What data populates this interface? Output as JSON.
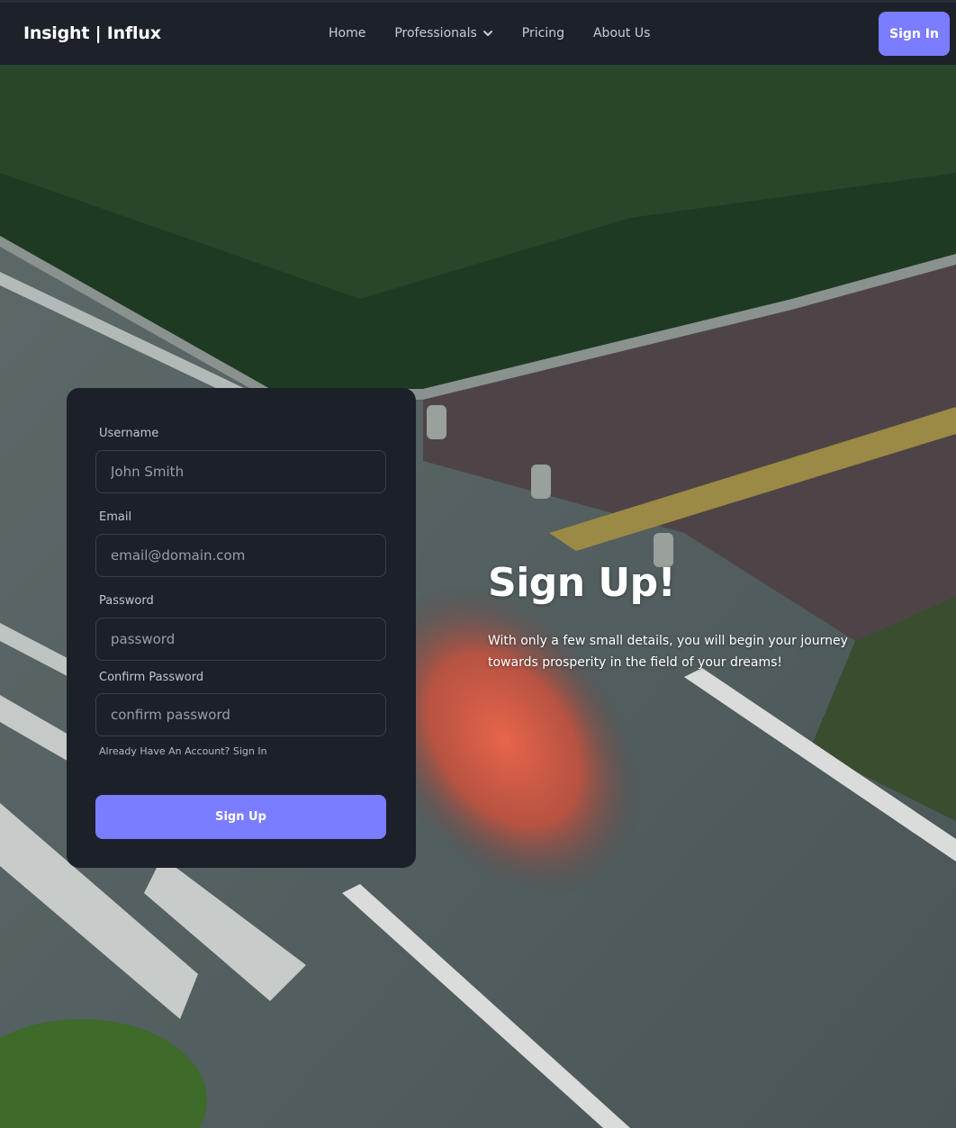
{
  "brand": {
    "name": "Insight | Influx"
  },
  "nav": {
    "links": [
      "Home",
      "Professionals",
      "Pricing",
      "About Us"
    ],
    "signin_label": "Sign In"
  },
  "form": {
    "username_label": "Username",
    "username_placeholder": "John Smith",
    "email_label": "Email",
    "email_placeholder": "email@domain.com",
    "password_label": "Password",
    "password_placeholder": "password",
    "confirm_label": "Confirm Password",
    "confirm_placeholder": "confirm password",
    "account_link": "Already Have An Account? Sign In",
    "submit_label": "Sign Up"
  },
  "hero": {
    "title": "Sign Up!",
    "text": "With only a few small details, you will begin your journey towards prosperity in the field of your dreams!"
  },
  "colors": {
    "accent": "#7a7dff",
    "nav_bg": "#1d222a",
    "card_bg": "#1c2029"
  },
  "icons": {
    "professionals_dropdown": "chevron-down-icon"
  }
}
